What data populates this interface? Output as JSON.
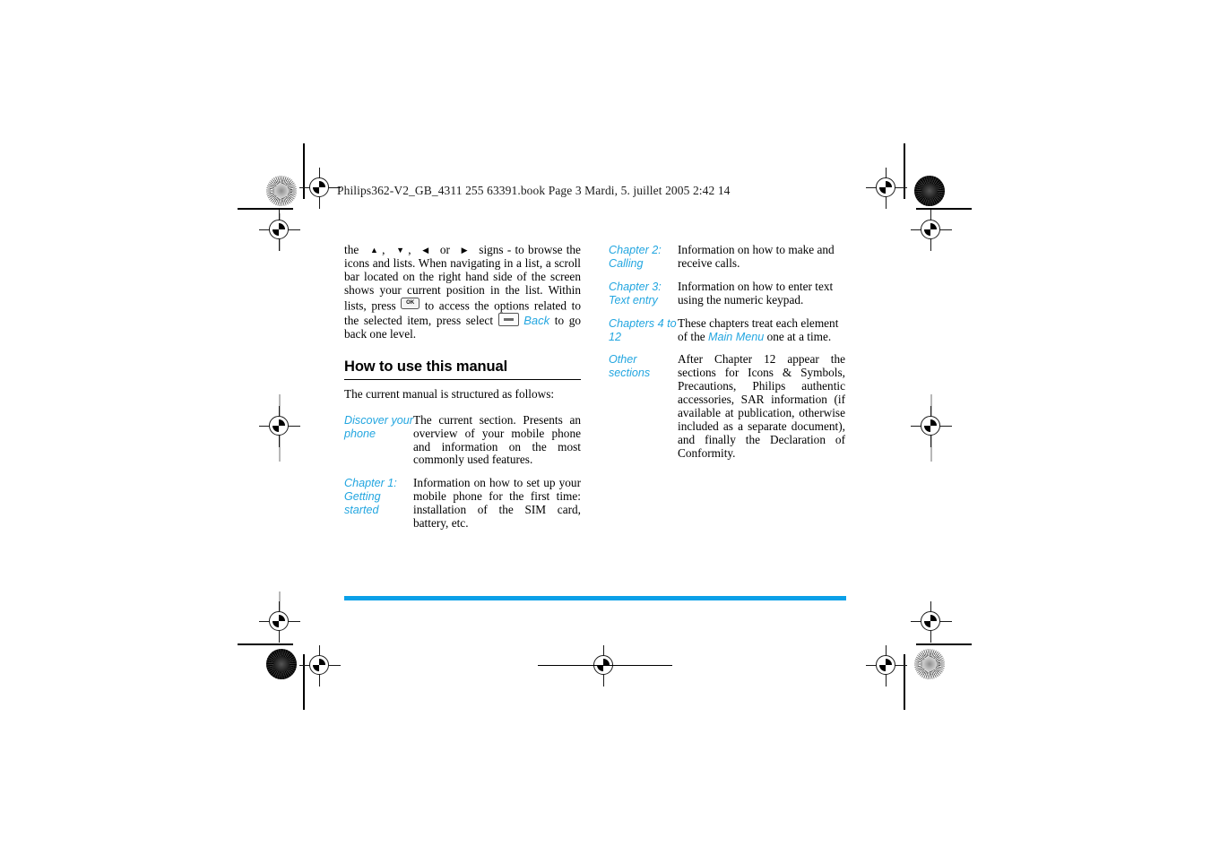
{
  "document": {
    "running_header": "Philips362-V2_GB_4311 255 63391.book   Page 3   Mardi, 5. juillet 2005  2:42 14",
    "accent_color": "#0aa0e8",
    "link_color": "#23a6e0"
  },
  "left_column": {
    "intro_paragraph": {
      "part1": "the",
      "arrow_up": "▲",
      "comma1": ",",
      "arrow_down": "▼",
      "comma2": ",",
      "arrow_left": "◀",
      "or": "or",
      "arrow_right": "▶",
      "part2": "signs - to browse the icons and lists. When navigating in a list, a scroll bar located on the right hand side of the screen shows your current position in the list. Within lists, press",
      "ok_key_label": "OK",
      "part3": "to access the options related to the selected item, press select",
      "back_label": "Back",
      "part4": "to go back one level."
    },
    "section_title": "How to use this manual",
    "intro_line": "The current manual is structured as follows:",
    "definitions": [
      {
        "term": "Discover your phone",
        "description": "The current section. Presents an overview of your mobile phone and information on the most commonly used features."
      },
      {
        "term": "Chapter 1: Getting started",
        "description": "Information on how to set up your mobile phone for the first time: installation of the SIM card, battery, etc."
      }
    ]
  },
  "right_column": {
    "definitions": [
      {
        "term": "Chapter 2: Calling",
        "description": "Information on how to make and receive calls."
      },
      {
        "term": "Chapter 3: Text entry",
        "description": "Information on how to enter text using the numeric keypad."
      },
      {
        "term": "Chapters 4 to 12",
        "description_before": "These chapters treat each element of the",
        "inline_emphasis": "Main Menu",
        "description_after": "one at a time."
      },
      {
        "term": "Other sections",
        "description": "After Chapter 12 appear the sections for Icons & Symbols, Precautions, Philips authentic accessories, SAR information (if available at publication, otherwise included as a separate document), and finally the Declaration of Conformity."
      }
    ]
  }
}
